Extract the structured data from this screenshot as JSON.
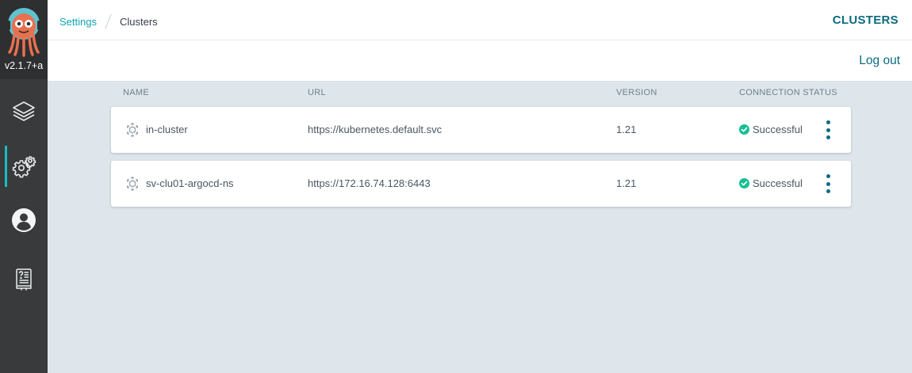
{
  "app": {
    "version": "v2.1.7+a"
  },
  "nav": [
    {
      "icon": "layers-icon",
      "label": "Applications"
    },
    {
      "icon": "gear-icon",
      "label": "Settings",
      "active": true
    },
    {
      "icon": "user-icon",
      "label": "User Info"
    },
    {
      "icon": "docs-icon",
      "label": "Documentation"
    }
  ],
  "breadcrumb": {
    "parent": "Settings",
    "current": "Clusters"
  },
  "header": {
    "title": "CLUSTERS",
    "logout_label": "Log out"
  },
  "table": {
    "columns": [
      "NAME",
      "URL",
      "VERSION",
      "CONNECTION STATUS"
    ],
    "rows": [
      {
        "name": "in-cluster",
        "url": "https://kubernetes.default.svc",
        "version": "1.21",
        "status": "Successful"
      },
      {
        "name": "sv-clu01-argocd-ns",
        "url": "https://172.16.74.128:6443",
        "version": "1.21",
        "status": "Successful"
      }
    ]
  },
  "colors": {
    "accent": "#0c6b80",
    "link": "#0da5b4",
    "success": "#18be94",
    "sidebar": "#393a3b"
  }
}
